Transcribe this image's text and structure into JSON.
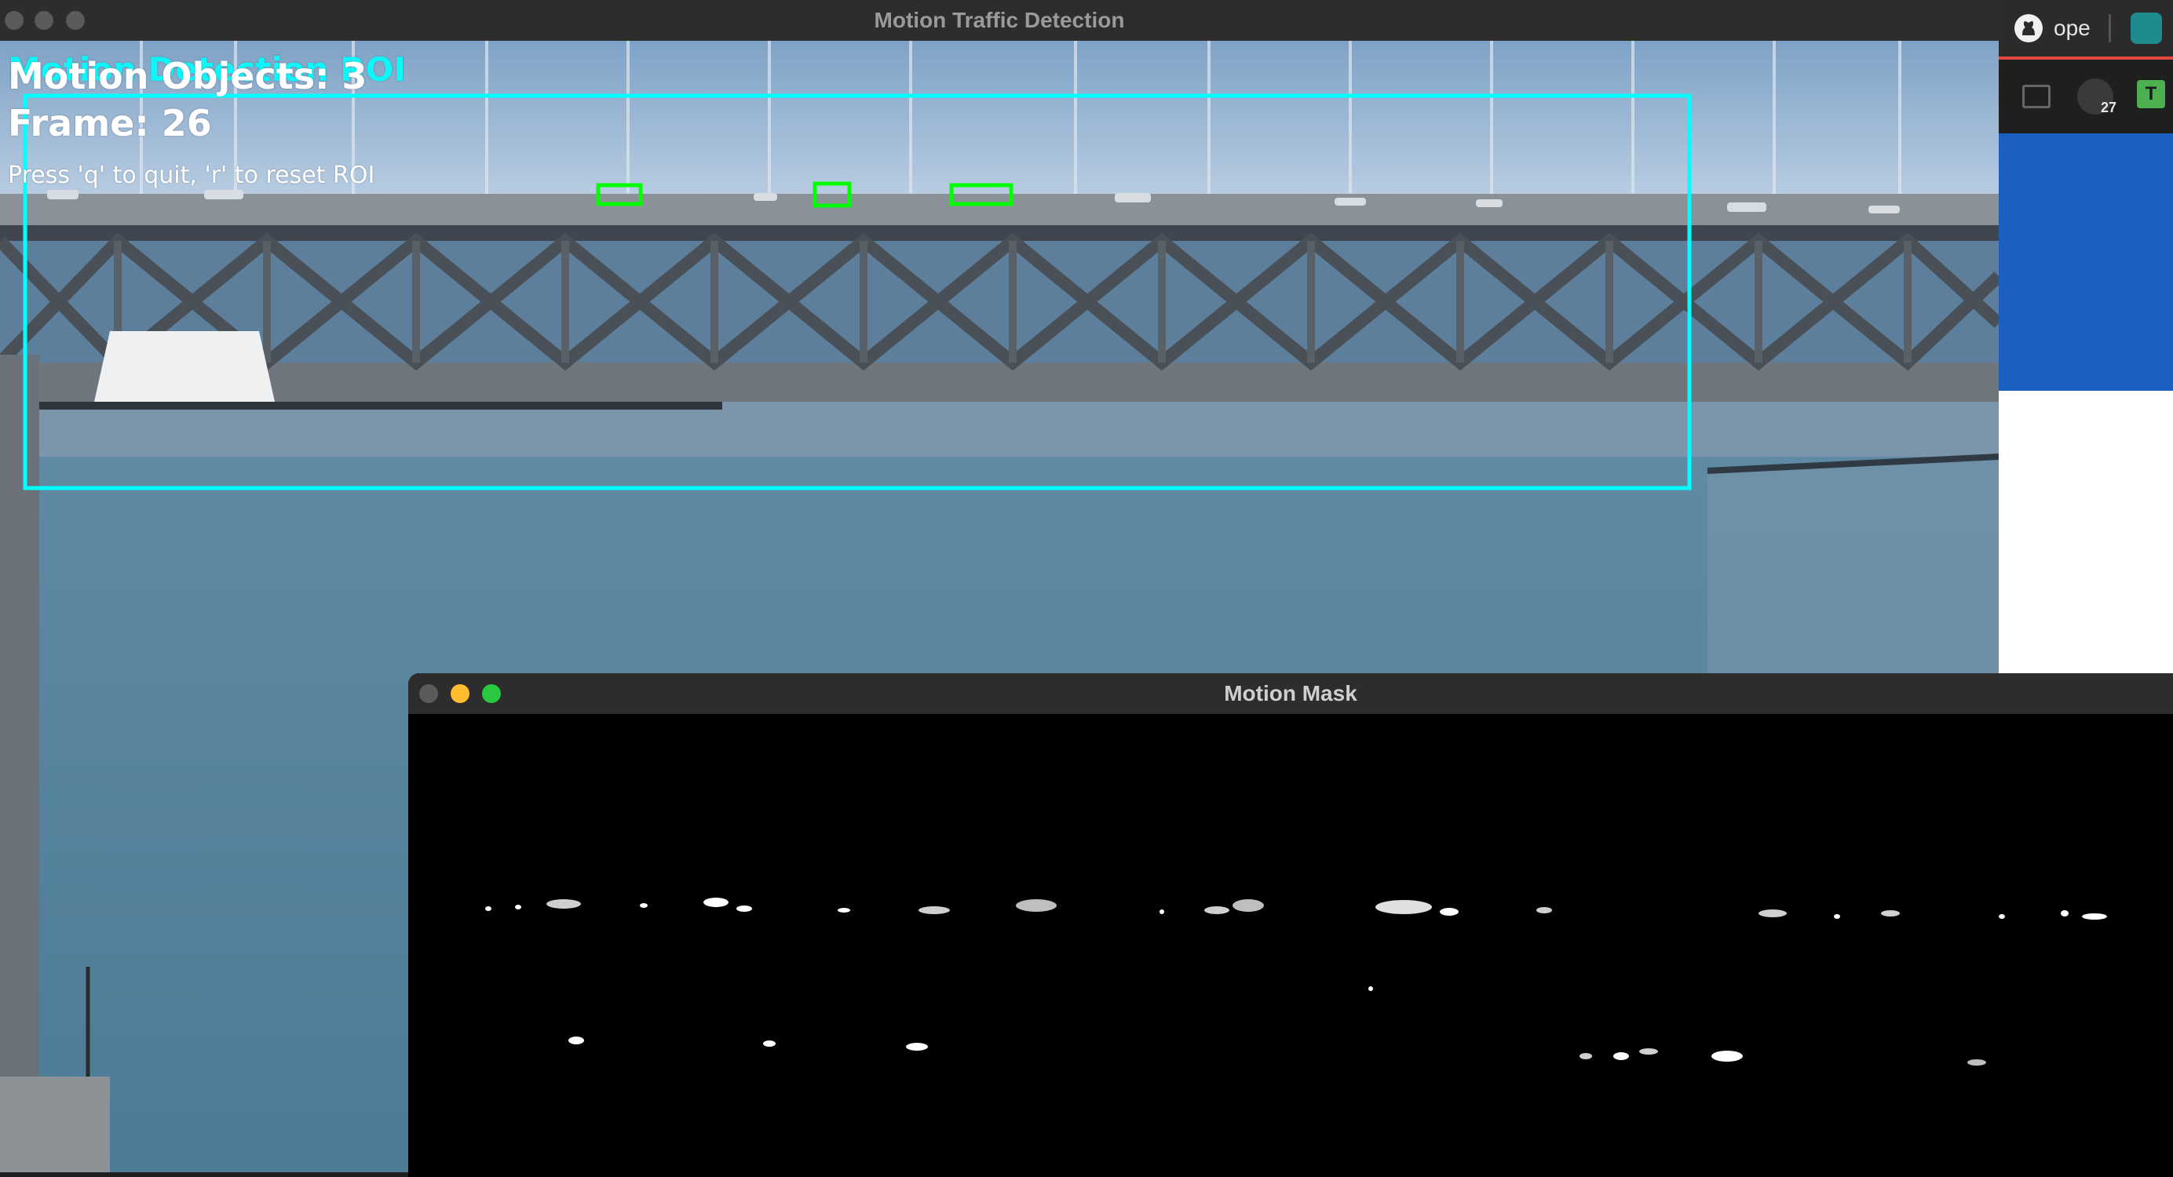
{
  "main_window": {
    "title": "Motion Traffic Detection",
    "overlay": {
      "roi_label": "Motion Detection ROI",
      "motion_objects": "Motion Objects: 3",
      "frame": "Frame: 26",
      "instructions": "Press 'q' to quit, 'r' to reset ROI"
    }
  },
  "mask_window": {
    "title": "Motion Mask"
  },
  "browser": {
    "tab_label": "ope",
    "badge_count": "27",
    "extension_letter": "T"
  },
  "colors": {
    "roi_box": "#00ffff",
    "detection_box": "#00ff00",
    "close": "#ff5f57",
    "minimize": "#febc2e",
    "maximize": "#28c840"
  },
  "icons": [
    "github-icon",
    "extension-icon",
    "window-icon"
  ]
}
